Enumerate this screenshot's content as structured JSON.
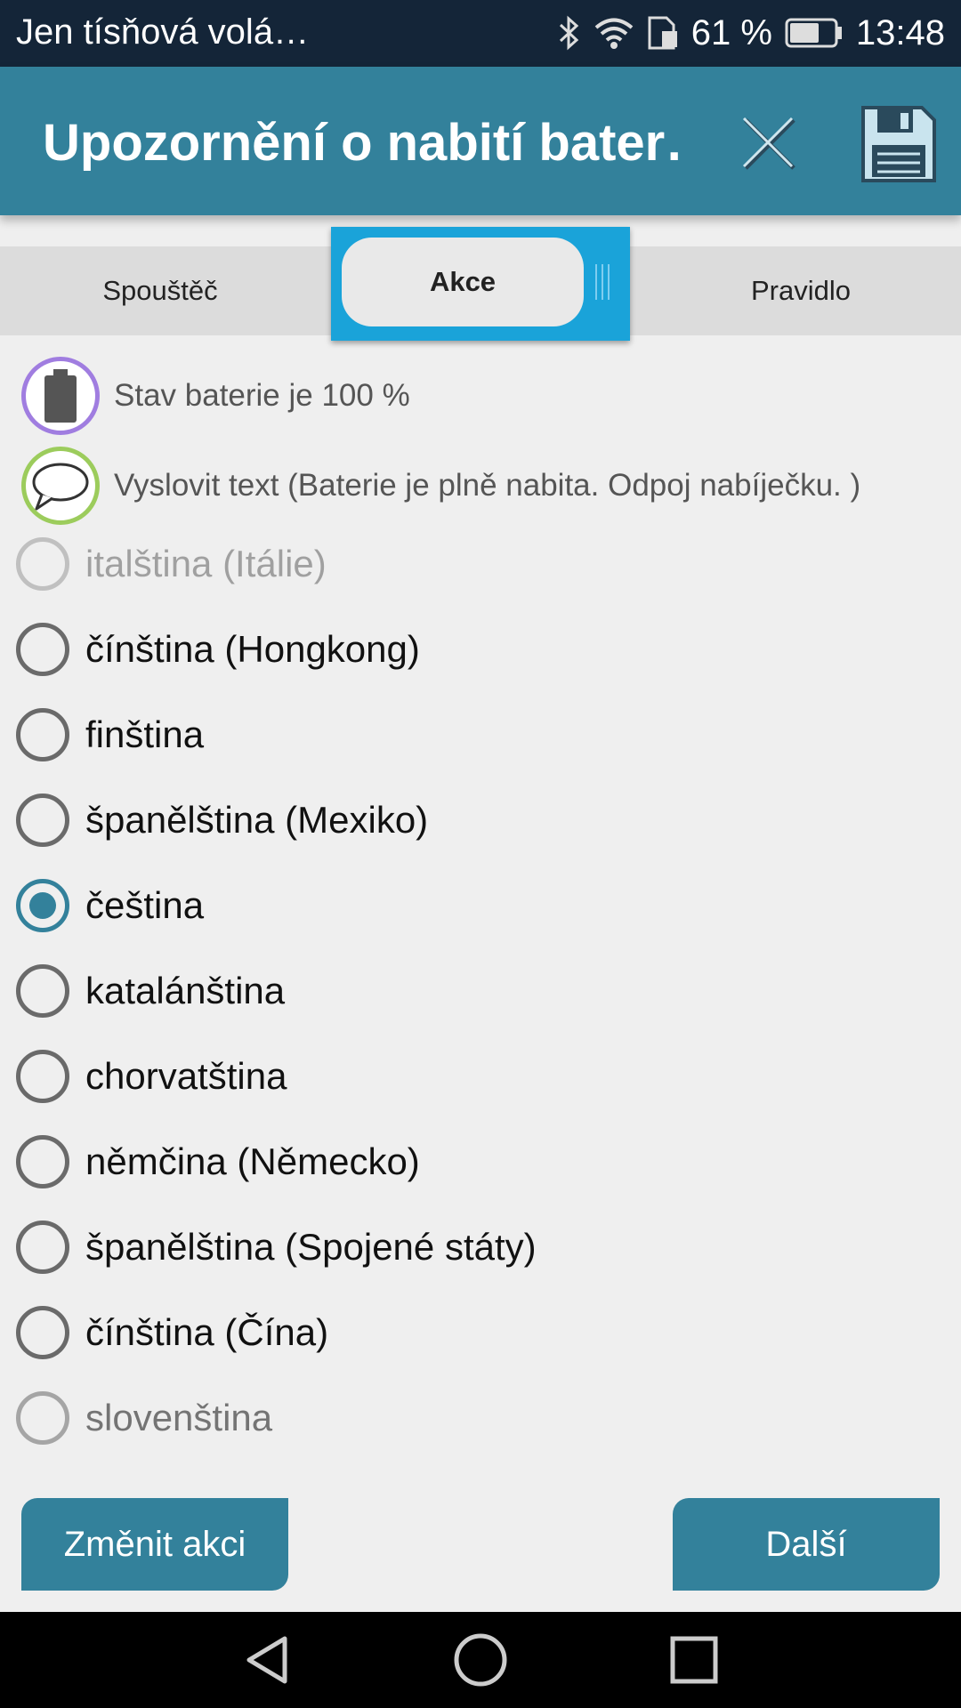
{
  "status_bar": {
    "carrier_text": "Jen tísňová volá…",
    "battery_percent": "61 %",
    "time": "13:48",
    "icons": [
      "bluetooth-icon",
      "wifi-icon",
      "sim-icon",
      "battery-icon"
    ]
  },
  "app_bar": {
    "title": "Upozornění o nabití bater…",
    "close_icon": "close-icon",
    "save_icon": "save-icon"
  },
  "tabs": {
    "trigger": "Spouštěč",
    "action": "Akce",
    "rule": "Pravidlo",
    "active": "action"
  },
  "actions": [
    {
      "icon": "battery-icon",
      "text": "Stav baterie je 100 %"
    },
    {
      "icon": "speech-bubble-icon",
      "text": "Vyslovit text (Baterie je plně nabita. Odpoj nabíječku. )"
    }
  ],
  "languages": {
    "selected": "čeština",
    "items": [
      "italština (Itálie)",
      "čínština (Hongkong)",
      "finština",
      "španělština (Mexiko)",
      "čeština",
      "katalánština",
      "chorvatština",
      "němčina (Německo)",
      "španělština (Spojené státy)",
      "čínština (Čína)",
      "slovenština"
    ]
  },
  "buttons": {
    "change_action": "Změnit akci",
    "next": "Další"
  },
  "colors": {
    "app_bar": "#33819b",
    "status_bar": "#142538",
    "tab_highlight": "#1aa3d9",
    "battery_ring": "#a07de0",
    "speech_ring": "#9ccc5c"
  }
}
